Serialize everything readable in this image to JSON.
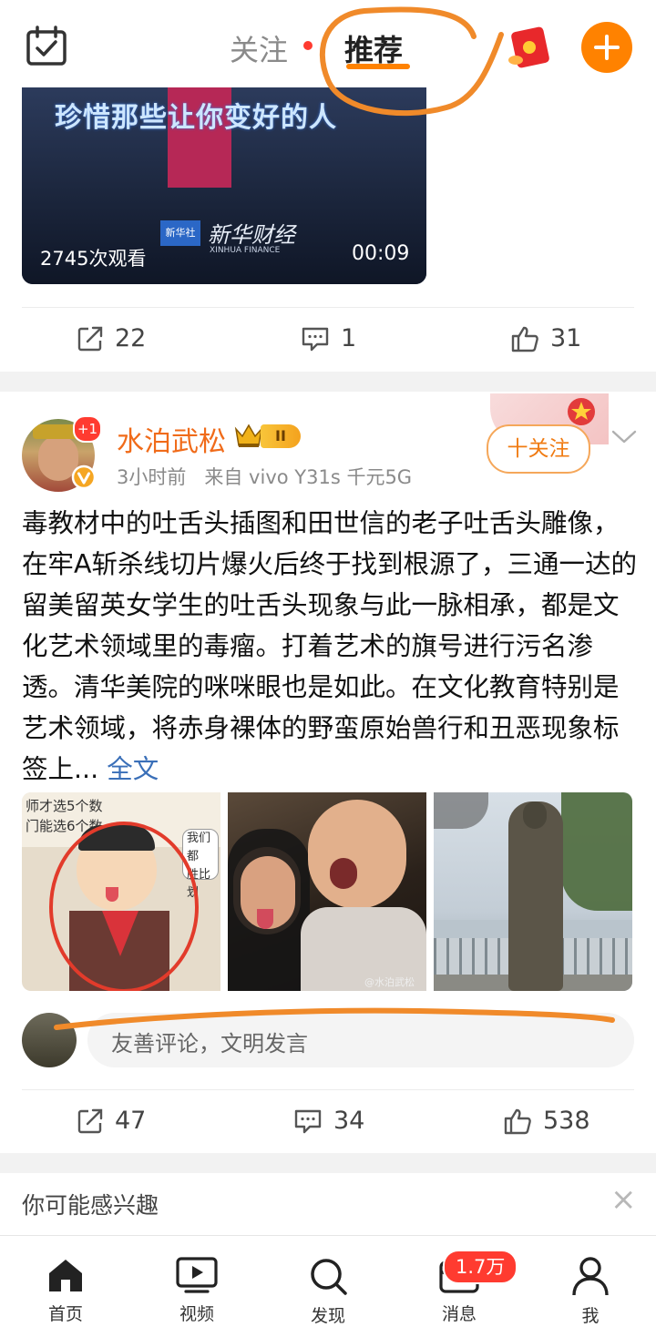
{
  "header": {
    "tab_follow": "关注",
    "tab_recommend": "推荐",
    "plus": "+"
  },
  "video_card": {
    "overlay_text": "珍惜那些让你变好的人",
    "views": "2745次观看",
    "duration": "00:09",
    "watermark_main": "新华财经",
    "watermark_sub": "XINHUA FINANCE",
    "logo_text": "新华社"
  },
  "post1_actions": {
    "share": "22",
    "comment": "1",
    "like": "31"
  },
  "post2": {
    "username": "水泊武松",
    "avatar_badge": "+1",
    "level_badge": "II",
    "meta": "3小时前   来自 vivo Y31s 千元5G",
    "follow_button": "十关注",
    "body": "毒教材中的吐舌头插图和田世信的老子吐舌头雕像，在牢A斩杀线切片爆火后终于找到根源了，三通一达的留美留英女学生的吐舌头现象与此一脉相承，都是文化艺术领域里的毒瘤。打着艺术的旗号进行污名渗透。清华美院的咪咪眼也是如此。在文化教育特别是艺术领域，将赤身裸体的野蛮原始兽行和丑恶现象标签上...",
    "full_text_link": "全文",
    "image1_text_a": "师才选5个数",
    "image1_text_b": "门能选6个数。",
    "image1_text_c": "我们都",
    "image1_text_d": "胜比划",
    "image2_watermark": "@水泊武松",
    "comment_placeholder": "友善评论，文明发言",
    "actions": {
      "share": "47",
      "comment": "34",
      "like": "538"
    }
  },
  "suggest": {
    "title": "你可能感兴趣",
    "close": "×"
  },
  "bottom_nav": {
    "items": [
      {
        "label": "首页"
      },
      {
        "label": "视频"
      },
      {
        "label": "发现"
      },
      {
        "label": "消息",
        "badge": "1.7万"
      },
      {
        "label": "我"
      }
    ]
  },
  "colors": {
    "accent": "#ff8200",
    "badge_red": "#ff3b30",
    "link_blue": "#3a6fb8",
    "annotation_orange": "#f08a2a"
  }
}
